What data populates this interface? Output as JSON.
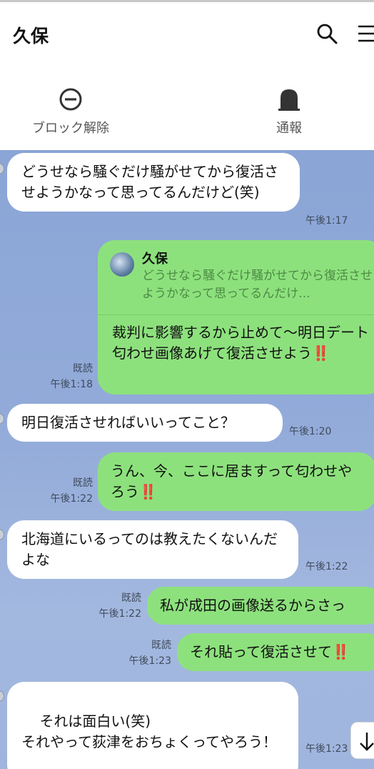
{
  "header": {
    "title": "久保",
    "actions": [
      {
        "label": "ブロック解除",
        "icon": "unblock-icon"
      },
      {
        "label": "通報",
        "icon": "report-icon"
      }
    ]
  },
  "messages": [
    {
      "type": "in",
      "text": "どうせなら騒ぐだけ騒がせてから復活させようかなって思ってるんだけど(笑)",
      "time": "午後1:17"
    },
    {
      "type": "out",
      "reply_to": {
        "name": "久保",
        "quote": "どうせなら騒ぐだけ騒がせてから復活させようかなって思ってるんだけ..."
      },
      "text": "裁判に影響するから止めて〜明日デート匂わせ画像あげて復活させよう",
      "emoji": "‼️",
      "read": "既読",
      "time": "午後1:18"
    },
    {
      "type": "in",
      "text": "明日復活させればいいってこと？",
      "time": "午後1:20"
    },
    {
      "type": "out",
      "text": "うん、今、ここに居ますって匂わせやろう",
      "emoji": "‼️",
      "read": "既読",
      "time": "午後1:22"
    },
    {
      "type": "in",
      "text": "北海道にいるってのは教えたくないんだよな",
      "time": "午後1:22"
    },
    {
      "type": "out",
      "text": "私が成田の画像送るからさっ",
      "read": "既読",
      "time": "午後1:22"
    },
    {
      "type": "out",
      "text": "それ貼って復活させて",
      "emoji": "‼️",
      "read": "既読",
      "time": "午後1:23"
    },
    {
      "type": "in",
      "text": "それは面白い(笑)\nそれやって荻津をおちょくってやろう！",
      "time": "午後1:23"
    }
  ],
  "colors": {
    "chat_bg": "#93abd9",
    "incoming": "#ffffff",
    "outgoing": "#8de17d",
    "quote": "#4d8a44"
  }
}
